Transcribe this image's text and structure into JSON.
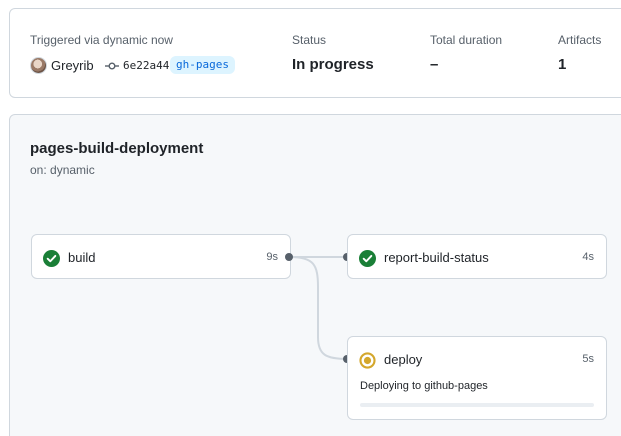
{
  "summary": {
    "trigger_label": "Triggered via dynamic now",
    "user": "Greyrib",
    "commit_sha": "6e22a44",
    "branch": "gh-pages",
    "status_label": "Status",
    "status_value": "In progress",
    "duration_label": "Total duration",
    "duration_value": "–",
    "artifacts_label": "Artifacts",
    "artifacts_value": "1"
  },
  "workflow": {
    "title": "pages-build-deployment",
    "trigger": "on: dynamic",
    "jobs": [
      {
        "name": "build",
        "duration": "9s",
        "status": "success"
      },
      {
        "name": "report-build-status",
        "duration": "4s",
        "status": "success"
      },
      {
        "name": "deploy",
        "duration": "5s",
        "status": "in_progress",
        "message": "Deploying to github-pages",
        "progress": 0
      }
    ]
  },
  "colors": {
    "success": "#1a7f37",
    "in_progress": "#d4a72c",
    "branch_bg": "#ddf4ff",
    "branch_text": "#0969da",
    "connector": "#d0d7de"
  },
  "icons": {
    "commit": "git-commit-icon",
    "success": "check-circle-icon",
    "in_progress": "in-progress-icon"
  }
}
